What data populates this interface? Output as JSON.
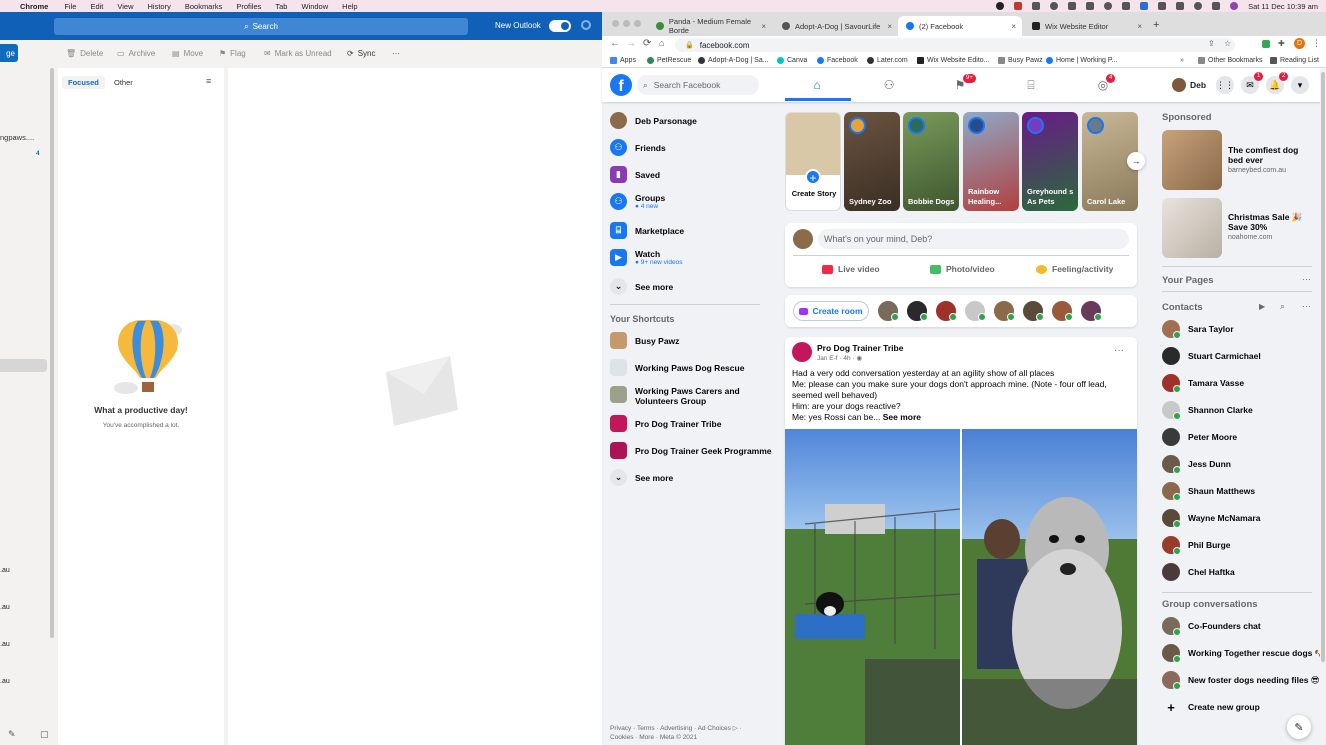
{
  "menubar": {
    "app": "Chrome",
    "items": [
      "File",
      "Edit",
      "View",
      "History",
      "Bookmarks",
      "Profiles",
      "Tab",
      "Window",
      "Help"
    ],
    "clock": "Sat 11 Dec  10:39 am"
  },
  "outlook": {
    "search_placeholder": "Search",
    "new_outlook_label": "New Outlook",
    "left_btn_fragment": "ge",
    "commands": [
      "Delete",
      "Archive",
      "Move",
      "Flag",
      "Mark as Unread",
      "Sync",
      "···"
    ],
    "pivot_focused": "Focused",
    "pivot_other": "Other",
    "folder_fragment": "ngpaws....",
    "folder_count": "4",
    "folder_au": ".au",
    "empty_title": "What a productive day!",
    "empty_subtitle": "You've accomplished a lot."
  },
  "chrome": {
    "tabs": [
      {
        "title": "Panda - Medium Female Borde",
        "color": "#3c8c3c"
      },
      {
        "title": "Adopt-A-Dog | SavourLife",
        "color": "#555555"
      },
      {
        "title": "(2) Facebook",
        "color": "#1877f2"
      },
      {
        "title": "Wix Website Editor",
        "color": "#222222"
      }
    ],
    "url": "facebook.com",
    "bookmarks": [
      "Apps",
      "PetRescue",
      "Adopt-A-Dog | Sa...",
      "Canva",
      "Facebook",
      "Later.com",
      "Wix Website Edito...",
      "Busy Pawz",
      "Home | Working P..."
    ],
    "other_bookmarks": "Other Bookmarks",
    "reading_list": "Reading List"
  },
  "facebook": {
    "search_placeholder": "Search Facebook",
    "badges": {
      "watch": "9+",
      "gaming": "4",
      "messenger": "1",
      "notifications": "2"
    },
    "profile_name": "Deb",
    "left_nav": [
      {
        "label": "Deb Parsonage",
        "sub": ""
      },
      {
        "label": "Friends",
        "sub": ""
      },
      {
        "label": "Saved",
        "sub": ""
      },
      {
        "label": "Groups",
        "sub": "4 new"
      },
      {
        "label": "Marketplace",
        "sub": ""
      },
      {
        "label": "Watch",
        "sub": "9+ new videos"
      },
      {
        "label": "See more",
        "sub": ""
      }
    ],
    "shortcuts_title": "Your Shortcuts",
    "shortcuts": [
      "Busy Pawz",
      "Working Paws Dog Rescue",
      "Working Paws Carers and Volunteers Group",
      "Pro Dog Trainer Tribe",
      "Pro Dog Trainer Geek Programme",
      "See more"
    ],
    "footer": "Privacy · Terms · Advertising · Ad Choices ▷ · Cookies · More · Meta © 2021",
    "stories": [
      {
        "name": "Create Story"
      },
      {
        "name": "Sydney Zoo"
      },
      {
        "name": "Bobbie Dogs"
      },
      {
        "name": "Rainbow Healing..."
      },
      {
        "name": "Greyhound s As Pets"
      },
      {
        "name": "Carol Lake"
      }
    ],
    "composer_placeholder": "What's on your mind, Deb?",
    "composer_actions": [
      "Live video",
      "Photo/video",
      "Feeling/activity"
    ],
    "create_room": "Create room",
    "post": {
      "author": "Pro Dog Trainer Tribe",
      "meta": "Jan E-f · 4h · ",
      "lines": [
        "Had a very odd conversation yesterday at an agility show of all places",
        "Me: please can you make sure your dogs don't approach mine. (Note - four off lead, seemed well behaved)",
        "Him: are your dogs reactive?",
        "Me: yes Rossi can be..."
      ],
      "see_more": "See more"
    },
    "sponsored_title": "Sponsored",
    "ads": [
      {
        "title": "The comfiest dog bed ever",
        "domain": "barneybed.com.au"
      },
      {
        "title": "Christmas Sale 🎉 Save 30%",
        "domain": "noahome.com"
      }
    ],
    "your_pages": "Your Pages",
    "contacts_title": "Contacts",
    "contacts": [
      "Sara Taylor",
      "Stuart Carmichael",
      "Tamara Vasse",
      "Shannon Clarke",
      "Peter Moore",
      "Jess Dunn",
      "Shaun Matthews",
      "Wayne McNamara",
      "Phil Burge",
      "Chel Haftka"
    ],
    "group_conv_title": "Group conversations",
    "groups": [
      "Co-Founders chat",
      "Working Together rescue dogs 🐶",
      "New foster dogs needing files 😎",
      "Create new group"
    ]
  }
}
